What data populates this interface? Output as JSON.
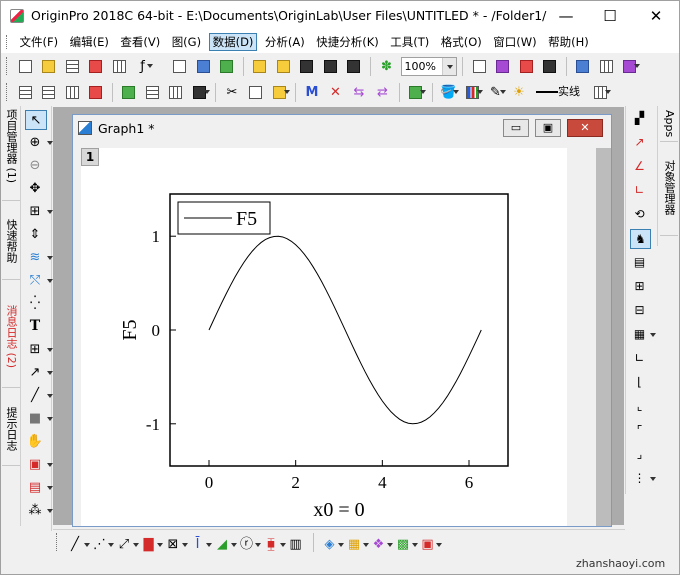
{
  "window": {
    "title": "OriginPro 2018C 64-bit - E:\\Documents\\OriginLab\\User Files\\UNTITLED * - /Folder1/",
    "min_glyph": "—",
    "max_glyph": "☐",
    "close_glyph": "✕"
  },
  "menubar": {
    "items": [
      {
        "label": "文件(F)"
      },
      {
        "label": "编辑(E)"
      },
      {
        "label": "查看(V)"
      },
      {
        "label": "图(G)"
      },
      {
        "label": "数据(D)"
      },
      {
        "label": "分析(A)"
      },
      {
        "label": "快捷分析(K)"
      },
      {
        "label": "工具(T)"
      },
      {
        "label": "格式(O)"
      },
      {
        "label": "窗口(W)"
      },
      {
        "label": "帮助(H)"
      }
    ],
    "active_item": "数据(D)"
  },
  "toolbar1": {
    "zoom_value": "100%"
  },
  "toolbar2": {
    "line_style_value": "实线"
  },
  "left_tabs": [
    {
      "label": "项目管理器 (1)"
    },
    {
      "label": "快速帮助"
    },
    {
      "label": "消息日志 (2)"
    },
    {
      "label": "提示日志"
    }
  ],
  "tools": {
    "text_tool_glyph": "T"
  },
  "right_tabs": [
    {
      "label": "Apps"
    },
    {
      "label": "对象管理器"
    }
  ],
  "graph_window": {
    "title": "Graph1 *",
    "layer_badge": "1",
    "min_glyph": "▭",
    "restore_glyph": "▣",
    "close_glyph": "✕"
  },
  "colors": {
    "menu_active_bg": "#cce4f7",
    "menu_active_border": "#3c7fb1",
    "mdi_background": "#ababab",
    "child_close": "#c84a3c",
    "message_log_tab": "#d42a2a",
    "plot_line": "#000000"
  },
  "chart_data": {
    "type": "line",
    "xlabel": "x0 = 0",
    "ylabel": "F5",
    "xlim": [
      -0.9,
      6.9
    ],
    "ylim": [
      -1.45,
      1.45
    ],
    "x_ticks": [
      0,
      2,
      4,
      6
    ],
    "y_ticks": [
      -1,
      0,
      1
    ],
    "grid": false,
    "legend": "top-left",
    "series": [
      {
        "name": "F5",
        "x_range": [
          0,
          6.283
        ],
        "x": [
          0.0,
          0.1,
          0.2,
          0.3,
          0.4,
          0.5,
          0.6,
          0.7,
          0.8,
          0.9,
          1.0,
          1.1,
          1.2,
          1.3,
          1.4,
          1.5,
          1.6,
          1.7,
          1.8,
          1.9,
          2.0,
          2.1,
          2.2,
          2.3,
          2.4,
          2.5,
          2.6,
          2.7,
          2.8,
          2.9,
          3.0,
          3.1,
          3.2,
          3.3,
          3.4,
          3.5,
          3.6,
          3.7,
          3.8,
          3.9,
          4.0,
          4.1,
          4.2,
          4.3,
          4.4,
          4.5,
          4.6,
          4.7,
          4.8,
          4.9,
          5.0,
          5.1,
          5.2,
          5.3,
          5.4,
          5.5,
          5.6,
          5.7,
          5.8,
          5.9,
          6.0,
          6.1,
          6.2,
          6.283
        ],
        "y": [
          0.0,
          0.1,
          0.199,
          0.296,
          0.389,
          0.479,
          0.565,
          0.644,
          0.717,
          0.783,
          0.841,
          0.891,
          0.932,
          0.964,
          0.985,
          0.997,
          1.0,
          0.992,
          0.974,
          0.946,
          0.909,
          0.863,
          0.808,
          0.746,
          0.675,
          0.598,
          0.516,
          0.427,
          0.335,
          0.239,
          0.141,
          0.042,
          -0.058,
          -0.158,
          -0.256,
          -0.351,
          -0.443,
          -0.53,
          -0.612,
          -0.688,
          -0.757,
          -0.818,
          -0.872,
          -0.916,
          -0.952,
          -0.978,
          -0.994,
          -1.0,
          -0.996,
          -0.982,
          -0.959,
          -0.926,
          -0.883,
          -0.832,
          -0.773,
          -0.706,
          -0.631,
          -0.551,
          -0.465,
          -0.374,
          -0.279,
          -0.182,
          -0.083,
          0.0
        ]
      }
    ]
  },
  "watermark": "zhanshaoyi.com"
}
